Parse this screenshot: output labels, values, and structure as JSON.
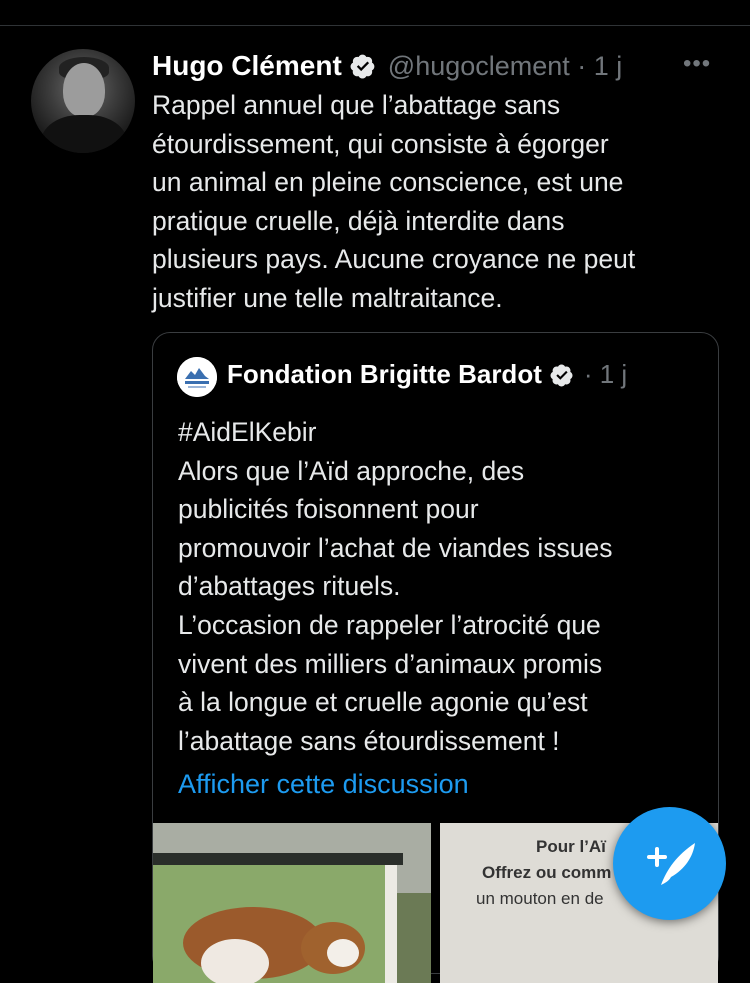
{
  "tweet": {
    "author_name": "Hugo Clément",
    "handle_time": "@hugoclement · 1 j",
    "more_label": "•••",
    "text": "Rappel annuel que l’abattage sans\nétourdissement, qui consiste à égorger\nun animal en pleine conscience, est une\npratique cruelle, déjà interdite dans\nplusieurs pays. Aucune croyance ne peut\njustifier une telle maltraitance."
  },
  "quote": {
    "author_name": "Fondation Brigitte Bardot",
    "time": "· 1 j",
    "text": "#AidElKebir\nAlors que l’Aïd approche, des\npublicités foisonnent pour\npromouvoir l’achat de viandes issues\nd’abattages rituels.\nL’occasion de rappeler l’atrocité que\nvivent des milliers d’animaux promis\nà la longue et cruelle agonie qu’est\nl’abattage sans étourdissement !",
    "show_thread": "Afficher cette discussion",
    "media_right_lines": [
      "Pour l’Aï",
      "Offrez ou comm",
      "un mouton en de"
    ]
  },
  "colors": {
    "background": "#000000",
    "text": "#e7e9ea",
    "secondary": "#71767b",
    "accent": "#1d9bf0"
  },
  "icons": {
    "verified": "verified-badge-icon",
    "more": "more-options-icon",
    "compose": "compose-tweet-icon"
  }
}
